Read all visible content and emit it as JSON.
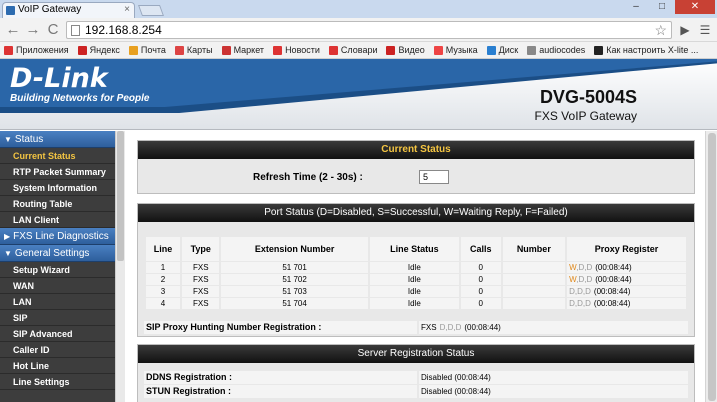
{
  "browser": {
    "tab_title": "VoIP Gateway",
    "tab_close": "×",
    "url": "192.168.8.254",
    "back": "←",
    "forward": "→",
    "reload": "C",
    "star": "☆",
    "menu": "☰",
    "minimize": "–",
    "maximize": "□",
    "close": "✕",
    "bookmarks": [
      {
        "label": "Приложения",
        "color": "#d33"
      },
      {
        "label": "Яндекс",
        "color": "#c22"
      },
      {
        "label": "Почта",
        "color": "#e8a020"
      },
      {
        "label": "Карты",
        "color": "#d44"
      },
      {
        "label": "Маркет",
        "color": "#c33"
      },
      {
        "label": "Новости",
        "color": "#d33"
      },
      {
        "label": "Словари",
        "color": "#d33"
      },
      {
        "label": "Видео",
        "color": "#c22"
      },
      {
        "label": "Музыка",
        "color": "#e44"
      },
      {
        "label": "Диск",
        "color": "#2a7fd0"
      },
      {
        "label": "audiocodes",
        "color": "#888"
      },
      {
        "label": "Как настроить X-lite ...",
        "color": "#222"
      }
    ]
  },
  "header": {
    "logo": "D-Link",
    "logo_tagline": "Building Networks for People",
    "model": "DVG-5004S",
    "model_sub": "FXS VoIP Gateway"
  },
  "sidebar": {
    "sections": [
      {
        "label": "Status",
        "expanded": true,
        "items": [
          "Current Status",
          "RTP Packet Summary",
          "System Information",
          "Routing Table",
          "LAN Client"
        ]
      },
      {
        "label": "FXS Line Diagnostics",
        "expanded": false,
        "items": []
      },
      {
        "label": "General Settings",
        "expanded": true,
        "items": [
          "Setup Wizard",
          "WAN",
          "LAN",
          "SIP",
          "SIP Advanced",
          "Caller ID",
          "Hot Line",
          "Line Settings"
        ]
      }
    ],
    "active_item": "Current Status"
  },
  "current_status": {
    "title": "Current Status",
    "refresh_label": "Refresh Time (2 - 30s) :",
    "refresh_value": "5"
  },
  "port_status": {
    "title": "Port Status (D=Disabled, S=Successful, W=Waiting Reply, F=Failed)",
    "columns": [
      "Line",
      "Type",
      "Extension Number",
      "Line Status",
      "Calls",
      "Number",
      "Proxy Register"
    ],
    "rows": [
      {
        "line": "1",
        "type": "FXS",
        "ext": "51 701",
        "status": "Idle",
        "calls": "0",
        "number": "",
        "proxy_codes": [
          "W",
          "D",
          "D"
        ],
        "proxy_time": "(00:08:44)"
      },
      {
        "line": "2",
        "type": "FXS",
        "ext": "51 702",
        "status": "Idle",
        "calls": "0",
        "number": "",
        "proxy_codes": [
          "W",
          "D",
          "D"
        ],
        "proxy_time": "(00:08:44)"
      },
      {
        "line": "3",
        "type": "FXS",
        "ext": "51 703",
        "status": "Idle",
        "calls": "0",
        "number": "",
        "proxy_codes": [
          "D",
          "D",
          "D"
        ],
        "proxy_time": "(00:08:44)"
      },
      {
        "line": "4",
        "type": "FXS",
        "ext": "51 704",
        "status": "Idle",
        "calls": "0",
        "number": "",
        "proxy_codes": [
          "D",
          "D",
          "D"
        ],
        "proxy_time": "(00:08:44)"
      }
    ],
    "sip_hunting_label": "SIP Proxy Hunting Number Registration :",
    "sip_hunting_prefix": "FXS",
    "sip_hunting_codes": [
      "D",
      "D",
      "D"
    ],
    "sip_hunting_time": "(00:08:44)"
  },
  "server_registration": {
    "title": "Server Registration Status",
    "rows": [
      {
        "label": "DDNS Registration :",
        "value": "Disabled (00:08:44)"
      },
      {
        "label": "STUN Registration :",
        "value": "Disabled (00:08:44)"
      }
    ]
  },
  "colors": {
    "waiting": "#e08a1e",
    "disabled": "#9a9a9a",
    "active_menu": "#f4c542",
    "section_header": "#3a6fb0"
  }
}
